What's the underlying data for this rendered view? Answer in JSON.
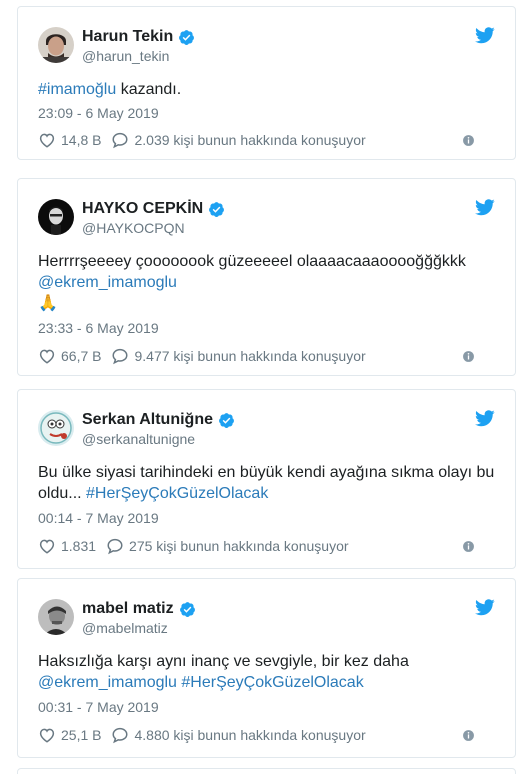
{
  "colors": {
    "link": "#2b7bb9",
    "verified": "#1da1f2",
    "bird": "#1da1f2",
    "muted": "#697882"
  },
  "tweets": [
    {
      "name": "Harun Tekin",
      "handle": "@harun_tekin",
      "text_link": "#imamoğlu",
      "text_rest": " kazandı.",
      "date": "23:09 - 6 May 2019",
      "likes": "14,8 B",
      "replies": "2.039 kişi bunun hakkında konuşuyor"
    },
    {
      "name": "HAYKO CEPKİN",
      "handle": "@HAYKOCPQN",
      "text_plain": "Herrrrşeeeey çoooooook güzeeeeel olaaaacaaaooooğğğkkk",
      "text_link": "@ekrem_imamoglu",
      "text_emoji": "🙏",
      "date": "23:33 - 6 May 2019",
      "likes": "66,7 B",
      "replies": "9.477 kişi bunun hakkında konuşuyor"
    },
    {
      "name": "Serkan Altuniğne",
      "handle": "@serkanaltunigne",
      "text_line1": "Bu ülke siyasi tarihindeki en büyük kendi ayağına sıkma olayı bu",
      "text_line2": "oldu... ",
      "text_link": "#HerŞeyÇokGüzelOlacak",
      "date": "00:14 - 7 May 2019",
      "likes": "1.831",
      "replies": "275 kişi bunun hakkında konuşuyor"
    },
    {
      "name": "mabel matiz",
      "handle": "@mabelmatiz",
      "text_plain": "Haksızlığa karşı aynı inanç ve sevgiyle, bir kez daha",
      "text_link1": "@ekrem_imamoglu",
      "text_link2": "#HerŞeyÇokGüzelOlacak",
      "date": "00:31 - 7 May 2019",
      "likes": "25,1 B",
      "replies": "4.880 kişi bunun hakkında konuşuyor"
    }
  ]
}
